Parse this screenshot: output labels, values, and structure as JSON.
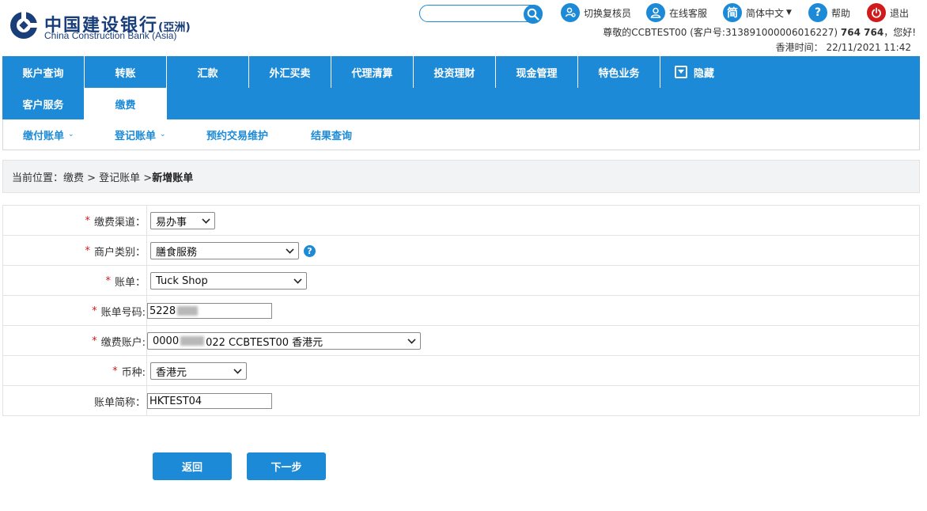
{
  "header": {
    "logo_cn": "中国建设银行",
    "logo_cn_suffix": "(亞洲)",
    "logo_en": "China Construction Bank (Asia)",
    "search_placeholder": "",
    "links": {
      "switch_reviewer": "切换复核员",
      "online_service": "在线客服",
      "language_icon": "简",
      "language": "简体中文",
      "help": "帮助",
      "logout": "退出"
    },
    "user_greeting": "尊敬的CCBTEST00 (客户号:313891000006016227)",
    "user_name": "764 764",
    "greeting_suffix": "，您好!",
    "time_label": "香港时间：",
    "time_value": "22/11/2021 11:42"
  },
  "nav": {
    "items": [
      "账户查询",
      "转账",
      "汇款",
      "外汇买卖",
      "代理清算",
      "投资理财",
      "现金管理",
      "特色业务"
    ],
    "hide": "隐藏",
    "row2": [
      "客户服务",
      "缴费"
    ],
    "active": "缴费"
  },
  "subnav": {
    "items": [
      "缴付账单",
      "登记账单",
      "预约交易维护",
      "结果查询"
    ]
  },
  "breadcrumb": {
    "prefix": "当前位置：缴费 > 登记账单 > ",
    "current": "新增账单"
  },
  "form": {
    "channel_label": "缴费渠道：",
    "channel_value": "易办事",
    "merchant_label": "商户类别：",
    "merchant_value": "膳食服務",
    "bill_label": "账单：",
    "bill_value": "Tuck Shop",
    "bill_no_label": "账单号码:",
    "bill_no_value": "5228",
    "account_label": "缴费账户:",
    "account_prefix": "0000",
    "account_suffix": "022 CCBTEST00 香港元",
    "currency_label": "币种:",
    "currency_value": "香港元",
    "alias_label": "账单简称：",
    "alias_value": "HKTEST04",
    "required_mark": "*",
    "help_icon": "?"
  },
  "buttons": {
    "back": "返回",
    "next": "下一步"
  },
  "colors": {
    "primary": "#1c8ad6",
    "required": "#d11a1a",
    "logo": "#1a3e7a"
  }
}
